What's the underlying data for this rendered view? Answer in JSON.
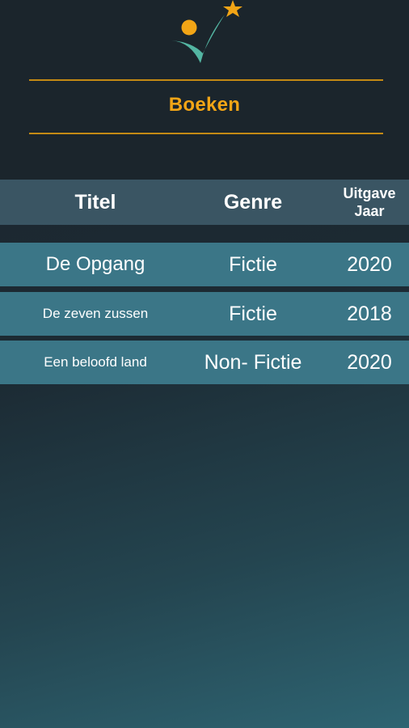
{
  "header": {
    "title": "Boeken",
    "logo_icon": "checkmark-star-logo",
    "accent_color": "#f2a516",
    "rule_color": "#c48a14"
  },
  "table": {
    "columns": {
      "title": "Titel",
      "genre": "Genre",
      "year_line1": "Uitgave",
      "year_line2": "Jaar"
    },
    "rows": [
      {
        "title": "De Opgang",
        "genre": "Fictie",
        "year": "2020"
      },
      {
        "title": "De zeven zussen",
        "genre": "Fictie",
        "year": "2018"
      },
      {
        "title": "Een beloofd land",
        "genre": "Non- Fictie",
        "year": "2020"
      }
    ],
    "header_color": "#3a5563",
    "row_color": "#3b7687"
  }
}
